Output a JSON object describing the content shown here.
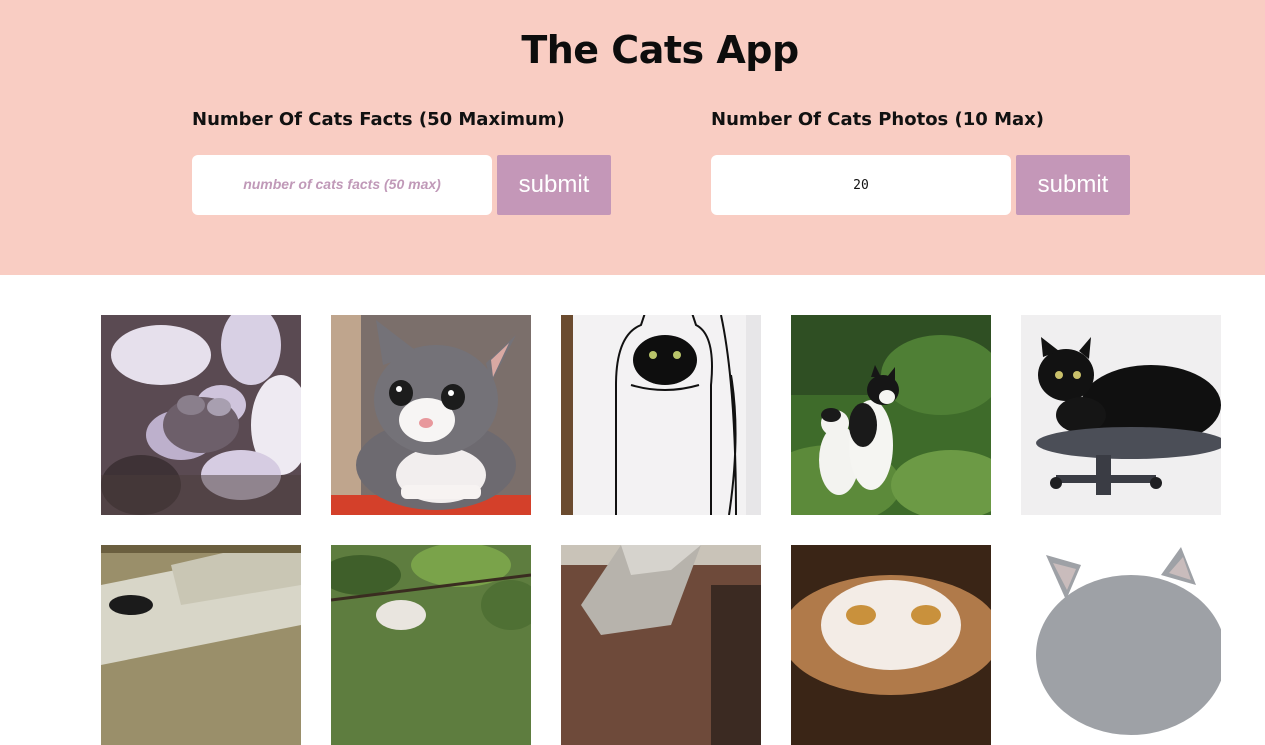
{
  "header": {
    "title": "The Cats App",
    "background": "#f9cdc3"
  },
  "facts_form": {
    "label": "Number Of Cats Facts (50 Maximum)",
    "placeholder": "number of cats facts (50 max)",
    "value": "",
    "submit_label": "submit"
  },
  "photos_form": {
    "label": "Number Of Cats Photos (10 Max)",
    "placeholder": "",
    "value": "20",
    "submit_label": "submit"
  },
  "accent_color": "#c497b8",
  "gallery": {
    "photos": [
      {
        "subject": "tabby cat in dappled sunlight"
      },
      {
        "subject": "gray and white kitten"
      },
      {
        "subject": "black cat in cardboard box costume"
      },
      {
        "subject": "two black and white cats on grass"
      },
      {
        "subject": "black cat on office chair"
      },
      {
        "subject": "cat on stone steps"
      },
      {
        "subject": "cat among green leaves"
      },
      {
        "subject": "cat near stone lantern"
      },
      {
        "subject": "orange and white cat close-up"
      },
      {
        "subject": "gray cat on white background"
      }
    ]
  }
}
